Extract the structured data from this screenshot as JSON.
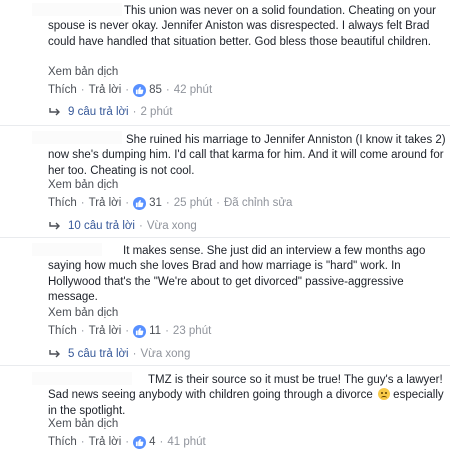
{
  "comments": [
    {
      "text": "This union was never on a solid foundation. Cheating on your spouse is never okay. Jennifer Aniston was disrespected. I always felt Brad could have handled that situation better. God bless those beautiful children.",
      "translate": "Xem bản dịch",
      "like_label": "Thích",
      "reply_label": "Trả lời",
      "reactions": "85",
      "time": "42 phút",
      "replies": "9 câu trả lời",
      "replies_time": "2 phút"
    },
    {
      "text": "She ruined his marriage to Jennifer Anniston (I know it takes 2) now she's dumping him. I'd call that karma for him. And it will come around for her too. Cheating is not cool.",
      "translate": "Xem bản dịch",
      "like_label": "Thích",
      "reply_label": "Trả lời",
      "reactions": "31",
      "time": "25 phút",
      "edited": "Đã chỉnh sửa",
      "replies": "10 câu trả lời",
      "replies_time": "Vừa xong"
    },
    {
      "text": "It makes sense. She just did an interview a few months ago saying how much she loves Brad and how marriage is \"hard\" work. In Hollywood that's the \"We're about to get divorced\" passive-aggressive message.",
      "translate": "Xem bản dịch",
      "like_label": "Thích",
      "reply_label": "Trả lời",
      "reactions": "11",
      "time": "23 phút",
      "replies": "5 câu trả lời",
      "replies_time": "Vừa xong"
    },
    {
      "text": "TMZ is their source so it must be true! The guy's a lawyer! Sad news seeing anybody with children going through a divorce",
      "text2": "especially in the spotlight.",
      "translate": "Xem bản dịch",
      "like_label": "Thích",
      "reply_label": "Trả lời",
      "reactions": "4",
      "time": "41 phút"
    }
  ],
  "colors": {
    "link": "#365899",
    "meta": "#90949c",
    "like": "#5890ff",
    "text": "#1d2129"
  },
  "icons": [
    "like-icon",
    "reply-arrow-icon",
    "sad-emoji-icon"
  ]
}
